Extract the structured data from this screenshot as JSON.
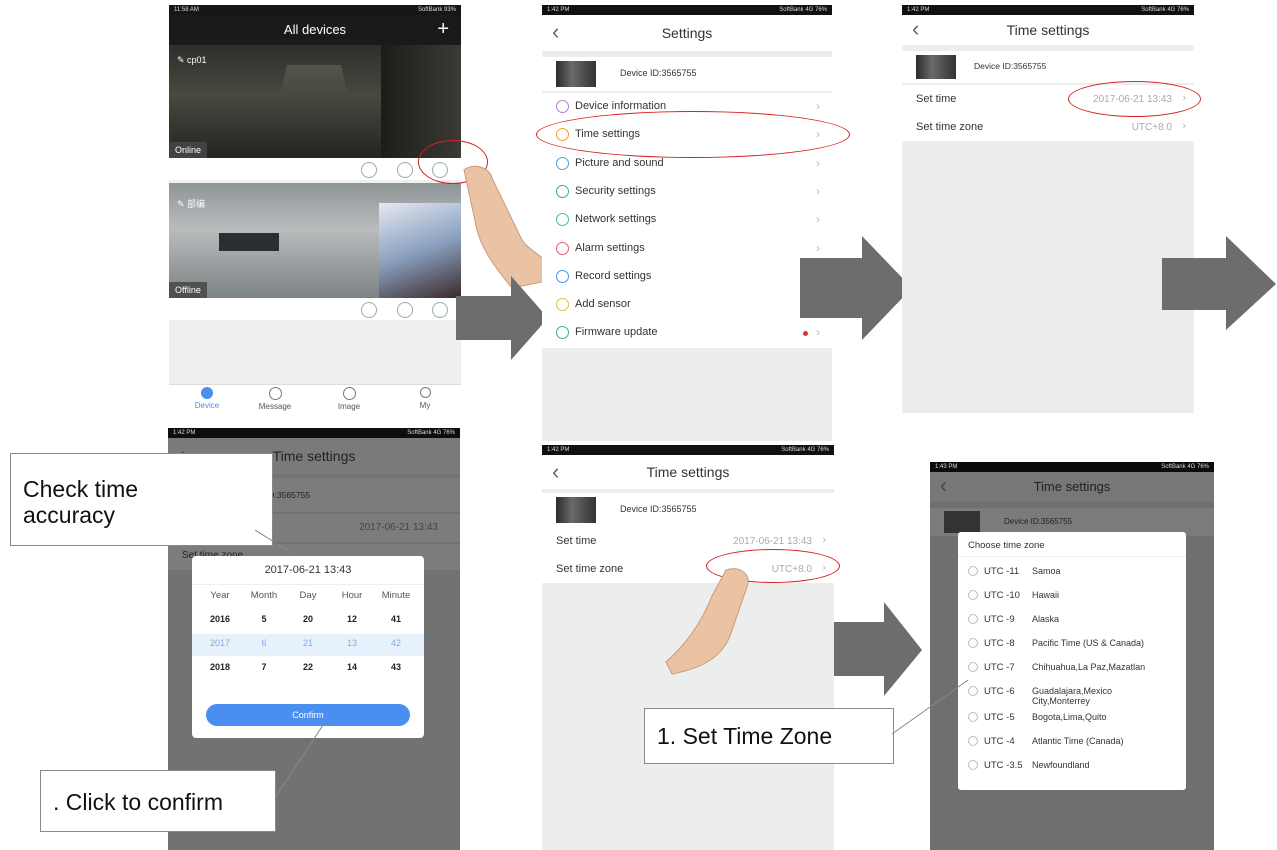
{
  "colors": {
    "accent": "#4a8ef0",
    "highlight": "#d72020",
    "arrow": "#6d6d6d"
  },
  "panel1": {
    "status_time": "11:58 AM",
    "status_right": "SoftBank 93%",
    "title": "All devices",
    "add_icon": "plus-icon",
    "cam1": {
      "name": "cp01",
      "status": "Online"
    },
    "cam2": {
      "name": "部编",
      "status": "Offline"
    },
    "tabs": [
      {
        "label": "Device"
      },
      {
        "label": "Message"
      },
      {
        "label": "Image"
      },
      {
        "label": "My"
      }
    ]
  },
  "panel2": {
    "status_time": "1:42 PM",
    "status_right": "SoftBank 4G 76%",
    "title": "Settings",
    "device_id": "Device ID:3565755",
    "menu": [
      {
        "label": "Device information",
        "icon": "info-icon",
        "color": "#b07fd0"
      },
      {
        "label": "Time settings",
        "icon": "clock-icon",
        "color": "#f0a030"
      },
      {
        "label": "Picture and sound",
        "icon": "picture-icon",
        "color": "#4aa0e0"
      },
      {
        "label": "Security settings",
        "icon": "shield-icon",
        "color": "#3cb371"
      },
      {
        "label": "Network settings",
        "icon": "wifi-icon",
        "color": "#3cc0b0"
      },
      {
        "label": "Alarm settings",
        "icon": "bell-icon",
        "color": "#e0607a"
      },
      {
        "label": "Record settings",
        "icon": "record-icon",
        "color": "#4a8ef0"
      },
      {
        "label": "Add sensor",
        "icon": "sensor-icon",
        "color": "#e0c040"
      },
      {
        "label": "Firmware update",
        "icon": "firmware-icon",
        "color": "#3cb371"
      }
    ]
  },
  "panel3": {
    "status_time": "1:42 PM",
    "status_right": "SoftBank 4G 76%",
    "title": "Time settings",
    "device_id": "Device ID:3565755",
    "set_time_label": "Set time",
    "set_time_value": "2017-06-21 13:43",
    "set_zone_label": "Set time zone",
    "set_zone_value": "UTC+8.0"
  },
  "panel4": {
    "status_time": "1:42 PM",
    "status_right": "SoftBank 4G 76%",
    "title": "Time settings",
    "device_id_partial": "ID:3565755",
    "set_time_value": "2017-06-21 13:43",
    "set_zone_partial": "Set time zone",
    "picker": {
      "header": "2017-06-21 13:43",
      "columns": [
        "Year",
        "Month",
        "Day",
        "Hour",
        "Minute"
      ],
      "rows": [
        [
          "2016",
          "5",
          "20",
          "12",
          "41"
        ],
        [
          "2017",
          "6",
          "21",
          "13",
          "42"
        ],
        [
          "2018",
          "7",
          "22",
          "14",
          "43"
        ]
      ],
      "confirm": "Confirm"
    },
    "callout_top_l1": "Check time",
    "callout_top_l2": "accuracy",
    "callout_bottom": ". Click to confirm"
  },
  "panel5": {
    "status_time": "1:42 PM",
    "status_right": "SoftBank 4G 76%",
    "title": "Time settings",
    "device_id": "Device ID:3565755",
    "set_time_label": "Set time",
    "set_time_value": "2017-06-21 13:43",
    "set_zone_label": "Set time zone",
    "set_zone_value": "UTC+8.0"
  },
  "panel6": {
    "status_time": "1:43 PM",
    "status_right": "SoftBank 4G 76%",
    "title": "Time settings",
    "device_id": "Device ID:3565755",
    "dialog_title": "Choose time zone",
    "zones": [
      {
        "offset": "UTC -11",
        "name": "Samoa"
      },
      {
        "offset": "UTC -10",
        "name": "Hawaii"
      },
      {
        "offset": "UTC -9",
        "name": "Alaska"
      },
      {
        "offset": "UTC -8",
        "name": "Pacific Time (US & Canada)"
      },
      {
        "offset": "UTC -7",
        "name": "Chihuahua,La Paz,Mazatlan"
      },
      {
        "offset": "UTC -6",
        "name": "Guadalajara,Mexico City,Monterrey"
      },
      {
        "offset": "UTC -5",
        "name": "Bogota,Lima,Quito"
      },
      {
        "offset": "UTC -4",
        "name": "Atlantic Time (Canada)"
      },
      {
        "offset": "UTC -3.5",
        "name": "Newfoundland"
      }
    ],
    "callout": "1. Set Time Zone"
  }
}
